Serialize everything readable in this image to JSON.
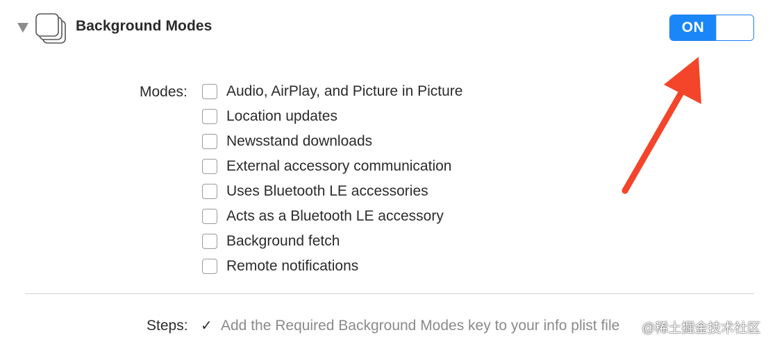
{
  "header": {
    "title": "Background Modes",
    "disclosure_icon": "disclosure-triangle-down-icon",
    "app_icon": "stacked-windows-icon"
  },
  "toggle": {
    "label": "ON",
    "state": true,
    "accent_color": "#1a86f7"
  },
  "modes": {
    "label": "Modes:",
    "items": [
      {
        "label": "Audio, AirPlay, and Picture in Picture",
        "checked": false
      },
      {
        "label": "Location updates",
        "checked": false
      },
      {
        "label": "Newsstand downloads",
        "checked": false
      },
      {
        "label": "External accessory communication",
        "checked": false
      },
      {
        "label": "Uses Bluetooth LE accessories",
        "checked": false
      },
      {
        "label": "Acts as a Bluetooth LE accessory",
        "checked": false
      },
      {
        "label": "Background fetch",
        "checked": false
      },
      {
        "label": "Remote notifications",
        "checked": false
      }
    ]
  },
  "steps": {
    "label": "Steps:",
    "check_glyph": "✓",
    "text": "Add the Required Background Modes key to your info plist file"
  },
  "annotation": {
    "arrow_color": "#f4452a"
  },
  "watermark": {
    "text": "@稀土掘金技术社区"
  }
}
